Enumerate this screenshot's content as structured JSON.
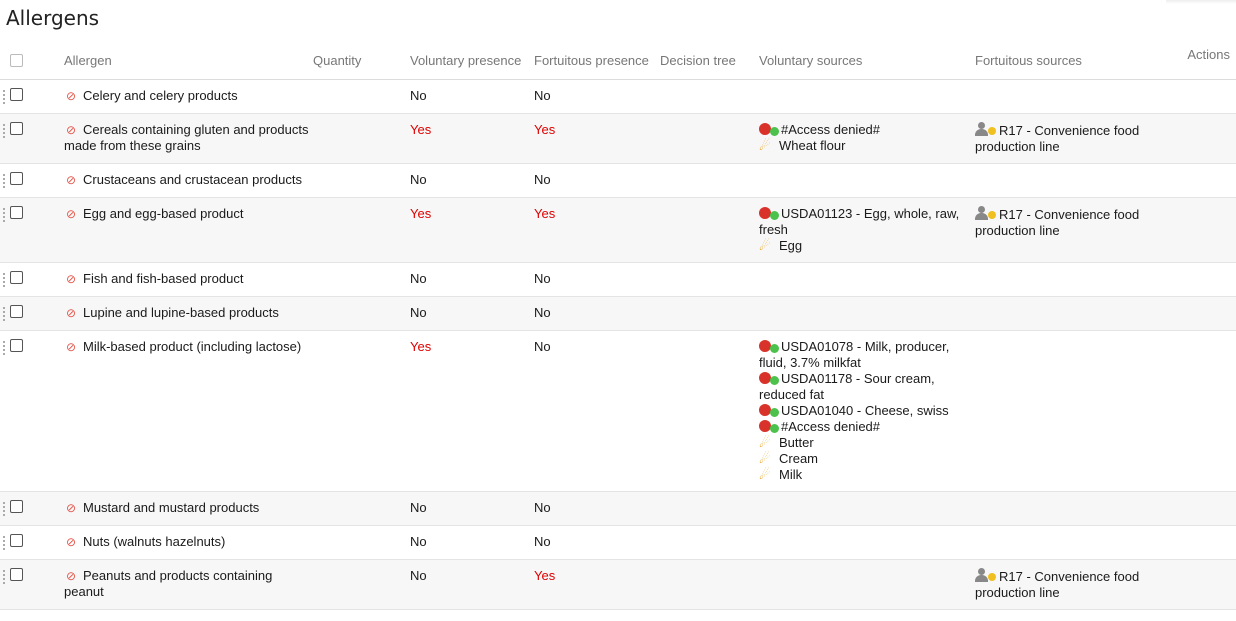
{
  "page": {
    "title": "Allergens"
  },
  "table": {
    "headers": {
      "allergen": "Allergen",
      "quantity": "Quantity",
      "voluntary_presence": "Voluntary presence",
      "fortuitous_presence": "Fortuitous presence",
      "decision_tree": "Decision tree",
      "voluntary_sources": "Voluntary sources",
      "fortuitous_sources": "Fortuitous sources",
      "actions": "Actions"
    },
    "rows": [
      {
        "allergen": "Celery and celery products",
        "voluntary": "No",
        "fortuitous": "No",
        "vsources": [],
        "fsources": []
      },
      {
        "allergen": "Cereals containing gluten and products made from these grains",
        "voluntary": "Yes",
        "fortuitous": "Yes",
        "vsources": [
          {
            "type": "raw-material",
            "label": "#Access denied#"
          },
          {
            "type": "ingredient",
            "label": "Wheat flour"
          }
        ],
        "fsources": [
          {
            "type": "resource",
            "label": "R17 - Convenience food production line"
          }
        ]
      },
      {
        "allergen": "Crustaceans and crustacean products",
        "voluntary": "No",
        "fortuitous": "No",
        "vsources": [],
        "fsources": []
      },
      {
        "allergen": "Egg and egg-based product",
        "voluntary": "Yes",
        "fortuitous": "Yes",
        "vsources": [
          {
            "type": "raw-material",
            "label": "USDA01123 - Egg, whole, raw, fresh"
          },
          {
            "type": "ingredient",
            "label": "Egg"
          }
        ],
        "fsources": [
          {
            "type": "resource",
            "label": "R17 - Convenience food production line"
          }
        ]
      },
      {
        "allergen": "Fish and fish-based product",
        "voluntary": "No",
        "fortuitous": "No",
        "vsources": [],
        "fsources": []
      },
      {
        "allergen": "Lupine and lupine-based products",
        "voluntary": "No",
        "fortuitous": "No",
        "vsources": [],
        "fsources": []
      },
      {
        "allergen": "Milk-based product (including lactose)",
        "voluntary": "Yes",
        "fortuitous": "No",
        "vsources": [
          {
            "type": "raw-material",
            "label": "USDA01078 - Milk, producer, fluid, 3.7% milkfat"
          },
          {
            "type": "raw-material",
            "label": "USDA01178 - Sour cream, reduced fat"
          },
          {
            "type": "raw-material",
            "label": "USDA01040 - Cheese, swiss"
          },
          {
            "type": "raw-material",
            "label": "#Access denied#"
          },
          {
            "type": "ingredient",
            "label": "Butter"
          },
          {
            "type": "ingredient",
            "label": "Cream"
          },
          {
            "type": "ingredient",
            "label": "Milk"
          }
        ],
        "fsources": []
      },
      {
        "allergen": "Mustard and mustard products",
        "voluntary": "No",
        "fortuitous": "No",
        "vsources": [],
        "fsources": []
      },
      {
        "allergen": "Nuts (walnuts hazelnuts)",
        "voluntary": "No",
        "fortuitous": "No",
        "vsources": [],
        "fsources": []
      },
      {
        "allergen": "Peanuts and products containing peanut",
        "voluntary": "No",
        "fortuitous": "Yes",
        "vsources": [],
        "fsources": [
          {
            "type": "resource",
            "label": "R17 - Convenience food production line"
          }
        ]
      }
    ]
  },
  "colors": {
    "yes": "#e00000",
    "allergen_icon": "#e2574c",
    "raw_material": "#d8322b",
    "ingredient": "#e8a320"
  },
  "icons": {
    "allergen": "no-allergen-icon",
    "raw-material": "raw-material-icon",
    "ingredient": "ingredient-icon",
    "resource": "resource-icon"
  }
}
